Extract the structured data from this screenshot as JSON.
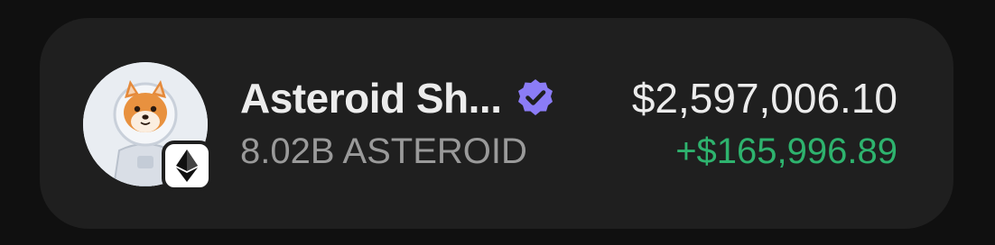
{
  "token": {
    "name": "Asteroid Sh...",
    "balance": "8.02B ASTEROID",
    "value": "$2,597,006.10",
    "change": "+$165,996.89",
    "avatar_icon": "shiba-astronaut-icon",
    "chain_icon": "ethereum-icon",
    "verified_icon": "verified-badge-icon"
  },
  "colors": {
    "background": "#101010",
    "card": "#1f1f1f",
    "primary_text": "#ececec",
    "secondary_text": "#9a9a9a",
    "positive": "#2eb36e",
    "verified": "#8b7cf6"
  }
}
